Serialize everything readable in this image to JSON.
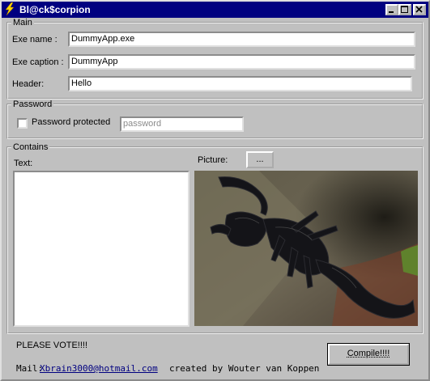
{
  "window": {
    "title": "Bl@ck$corpion",
    "icon": "lightning-bolt-icon",
    "controls": [
      "minimize-icon",
      "maximize-icon",
      "close-icon"
    ]
  },
  "main_group": {
    "legend": "Main",
    "exe_name_label": "Exe name :",
    "exe_name_value": "DummyApp.exe",
    "exe_caption_label": "Exe caption :",
    "exe_caption_value": "DummyApp",
    "header_label": "Header:",
    "header_value": "Hello"
  },
  "password_group": {
    "legend": "Password",
    "checkbox_label": "Password protected",
    "checkbox_checked": false,
    "password_placeholder": "password"
  },
  "contains_group": {
    "legend": "Contains",
    "text_label": "Text:",
    "text_value": "",
    "picture_label": "Picture:",
    "browse_label": "...",
    "picture_description": "scorpion-photo"
  },
  "footer": {
    "vote_text": "PLEASE VOTE!!!!",
    "mail_label": "Mail:",
    "mail_link": "Xbrain3000@hotmail.com",
    "credit": "created by Wouter van Koppen",
    "compile_label": "Compile!!!!"
  }
}
